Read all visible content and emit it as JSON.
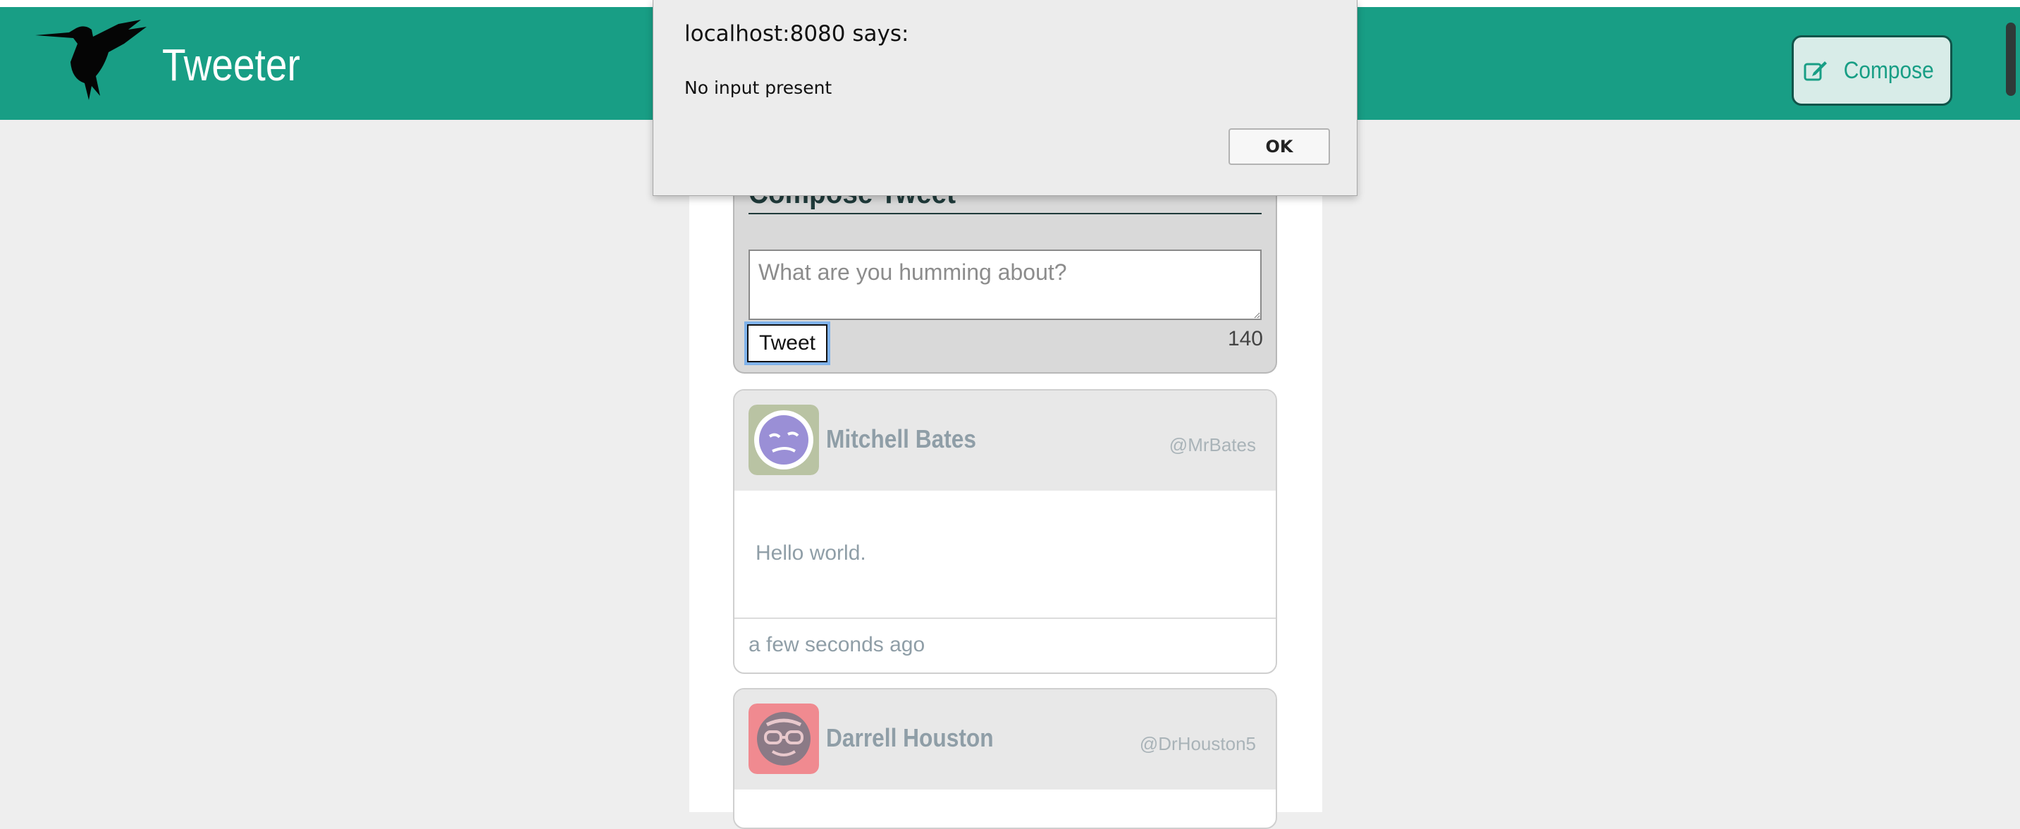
{
  "navbar": {
    "brand": "Tweeter",
    "compose_label": "Compose",
    "compose_icon": "edit-icon",
    "background": "#189e85"
  },
  "compose": {
    "title": "Compose Tweet",
    "placeholder": "What are you humming about?",
    "button_label": "Tweet",
    "counter": "140"
  },
  "tweets": [
    {
      "name": "Mitchell Bates",
      "handle": "@MrBates",
      "content": "Hello world.",
      "time": "a few seconds ago",
      "avatar_color": "#b9c3a3"
    },
    {
      "name": "Darrell Houston",
      "handle": "@DrHouston5",
      "avatar_color": "#f08a90"
    }
  ],
  "dialog": {
    "title": "localhost:8080 says:",
    "message": "No input present",
    "ok_label": "OK"
  }
}
